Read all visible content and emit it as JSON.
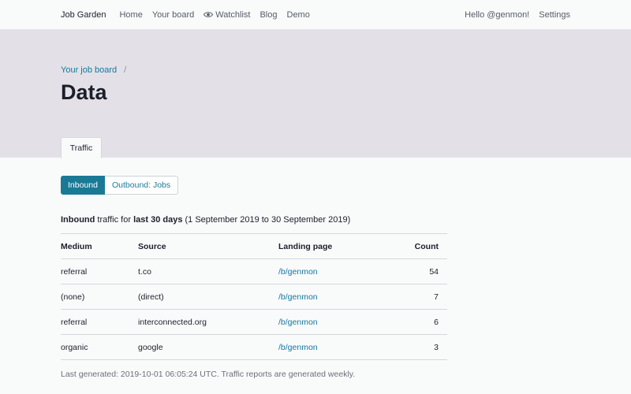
{
  "nav": {
    "brand": "Job Garden",
    "links": [
      "Home",
      "Your board",
      "Watchlist",
      "Blog",
      "Demo"
    ],
    "greeting": "Hello @genmon!",
    "settings": "Settings"
  },
  "breadcrumb": {
    "link": "Your job board",
    "separator": "/"
  },
  "page": {
    "title": "Data",
    "tab": "Traffic"
  },
  "toggle": {
    "inbound": "Inbound",
    "outbound": "Outbound: Jobs"
  },
  "summary": {
    "bold1": "Inbound",
    "text1": " traffic for ",
    "bold2": "last 30 days",
    "text2": " (1 September 2019 to 30 September 2019)"
  },
  "table": {
    "headers": {
      "medium": "Medium",
      "source": "Source",
      "landing": "Landing page",
      "count": "Count"
    },
    "rows": [
      {
        "medium": "referral",
        "source": "t.co",
        "landing": "/b/genmon",
        "count": "54"
      },
      {
        "medium": "(none)",
        "source": "(direct)",
        "landing": "/b/genmon",
        "count": "7"
      },
      {
        "medium": "referral",
        "source": "interconnected.org",
        "landing": "/b/genmon",
        "count": "6"
      },
      {
        "medium": "organic",
        "source": "google",
        "landing": "/b/genmon",
        "count": "3"
      }
    ]
  },
  "footnote": "Last generated: 2019-10-01 06:05:24 UTC. Traffic reports are generated weekly.",
  "colors": {
    "accent": "#1a7a96",
    "link": "#1577a0",
    "hero": "#e3e1e7"
  },
  "icons": {
    "watchlist": "eye-icon"
  }
}
